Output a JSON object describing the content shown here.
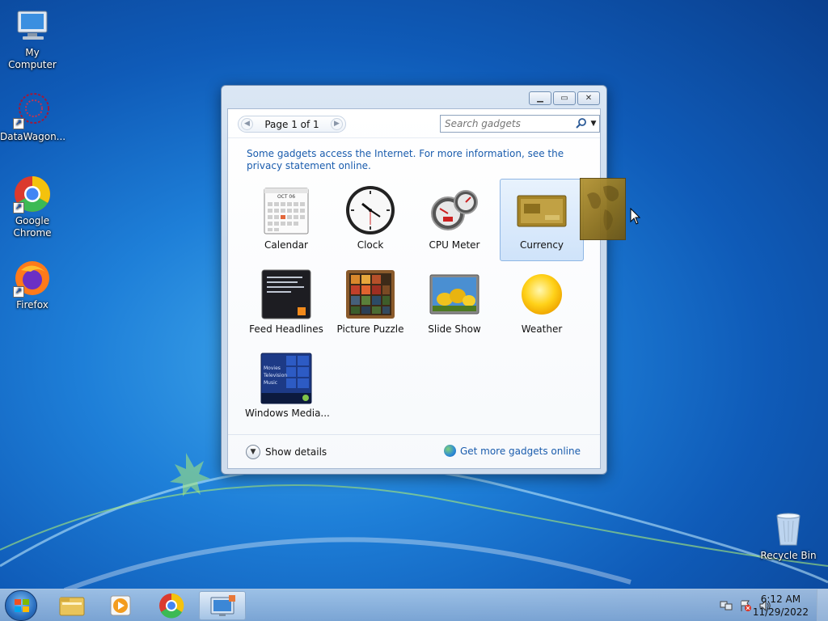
{
  "desktop": {
    "icons": [
      {
        "label": "My Computer"
      },
      {
        "label": "DataWagon..."
      },
      {
        "label": "Google\nChrome"
      },
      {
        "label": "Firefox"
      },
      {
        "label": "Recycle Bin"
      }
    ]
  },
  "window": {
    "pager": {
      "label": "Page 1 of 1"
    },
    "search": {
      "placeholder": "Search gadgets"
    },
    "notice": {
      "text": "Some gadgets access the Internet.  For more information, see the privacy statement online."
    },
    "gadgets": [
      {
        "label": "Calendar"
      },
      {
        "label": "Clock"
      },
      {
        "label": "CPU Meter"
      },
      {
        "label": "Currency"
      },
      {
        "label": "Feed Headlines"
      },
      {
        "label": "Picture Puzzle"
      },
      {
        "label": "Slide Show"
      },
      {
        "label": "Weather"
      },
      {
        "label": "Windows Media..."
      }
    ],
    "selected_gadget": "Currency",
    "calendar_month": "OCT 06",
    "media_lines": [
      "Movies",
      "Television",
      "Music"
    ],
    "footer": {
      "show_details": "Show details",
      "get_more": "Get more gadgets online"
    }
  },
  "taskbar": {
    "time": "6:12 AM",
    "date": "11/29/2022"
  },
  "colors": {
    "link": "#1a5cad",
    "selection": "#cfe3fa",
    "desktop_blue": "#1e7fd8"
  }
}
